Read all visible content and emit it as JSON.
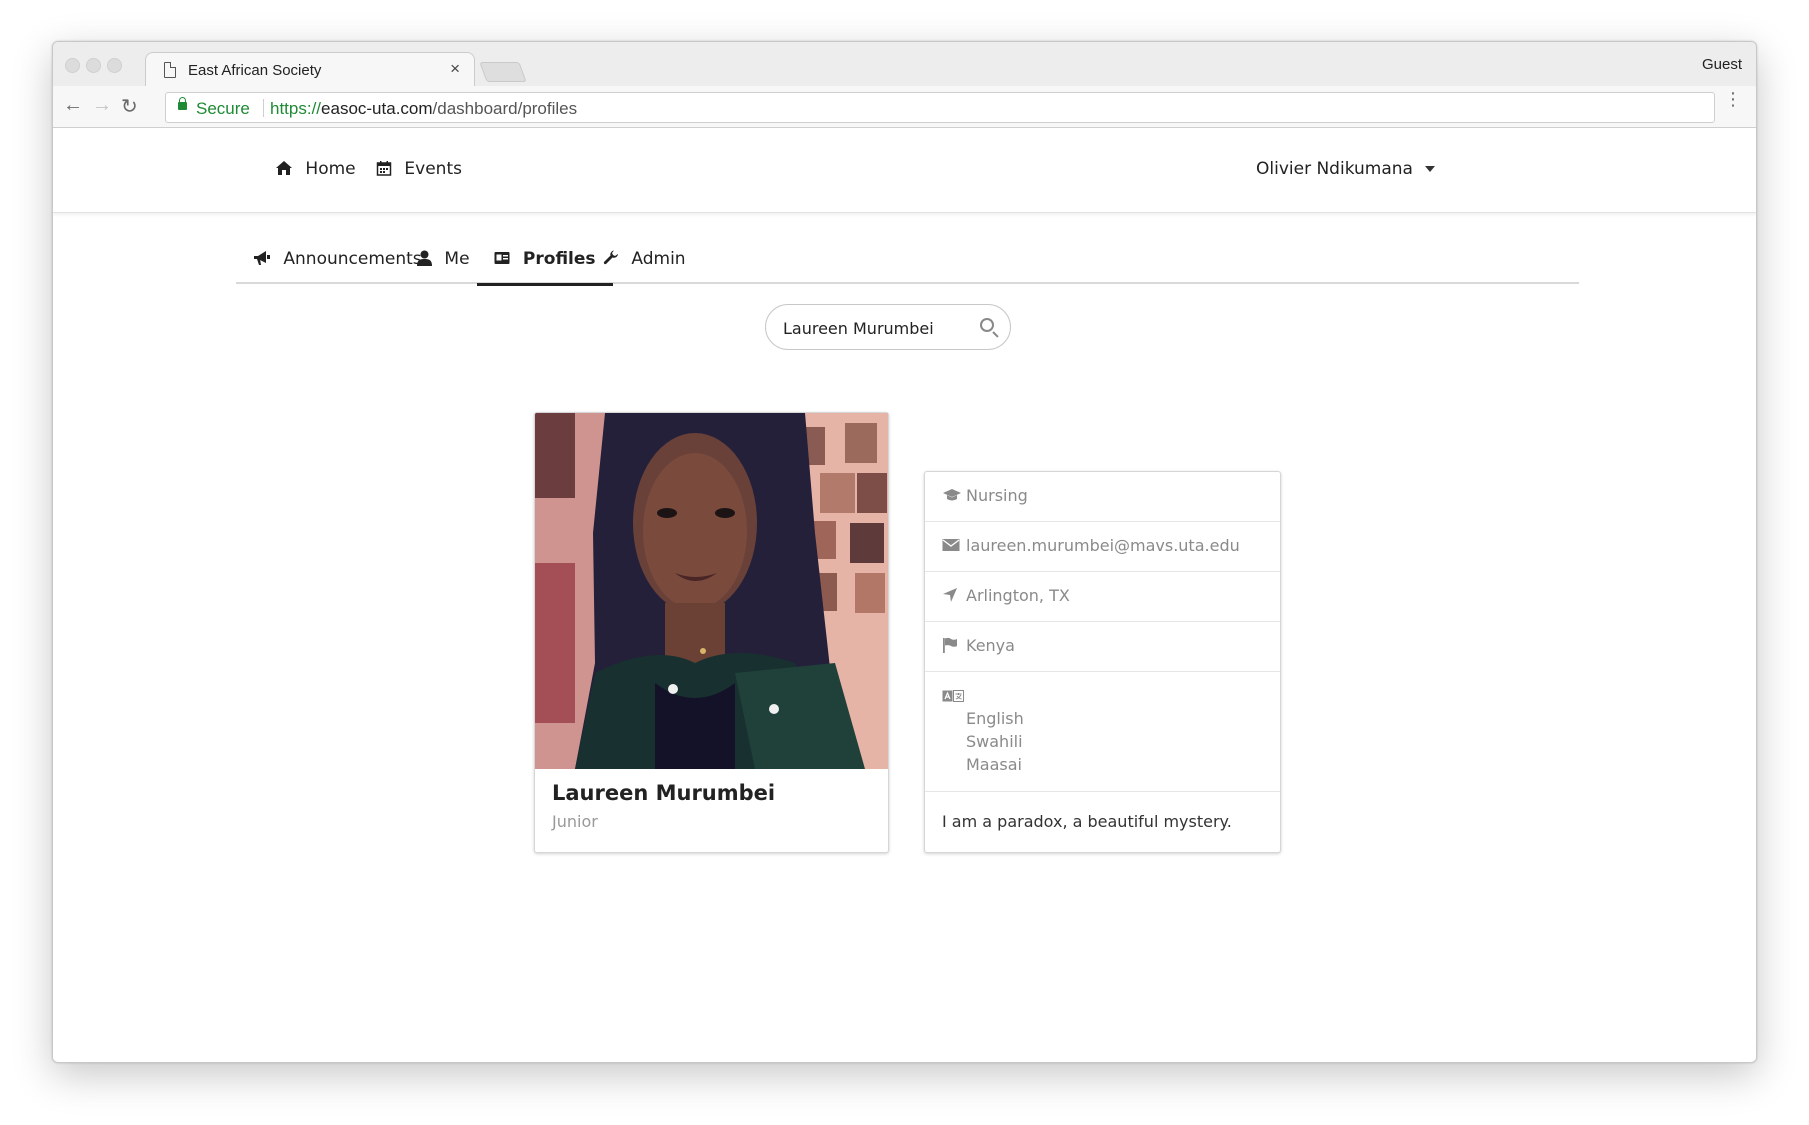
{
  "browser": {
    "tab_title": "East African Society",
    "close_glyph": "×",
    "guest_label": "Guest",
    "secure_label": "Secure",
    "url_scheme": "https://",
    "url_host": "easoc-uta.com",
    "url_path": "/dashboard/profiles"
  },
  "topnav": {
    "home_label": "Home",
    "events_label": "Events",
    "user_name": "Olivier Ndikumana"
  },
  "tabs": {
    "announcements": "Announcements",
    "me": "Me",
    "profiles": "Profiles",
    "admin": "Admin",
    "active": "Profiles"
  },
  "search": {
    "value": "Laureen Murumbei"
  },
  "profile": {
    "name": "Laureen Murumbei",
    "year": "Junior",
    "major": "Nursing",
    "email": "laureen.murumbei@mavs.uta.edu",
    "location": "Arlington, TX",
    "country": "Kenya",
    "languages": [
      "English",
      "Swahili",
      "Maasai"
    ],
    "bio": "I am a paradox, a beautiful mystery."
  },
  "icons": {
    "home": "home-icon",
    "events": "calendar-icon",
    "announcements": "bullhorn-icon",
    "me": "user-icon",
    "profiles": "id-card-icon",
    "admin": "wrench-icon",
    "search": "search-icon",
    "major": "graduation-cap-icon",
    "email": "envelope-icon",
    "location": "location-arrow-icon",
    "country": "flag-icon",
    "languages": "language-icon"
  }
}
